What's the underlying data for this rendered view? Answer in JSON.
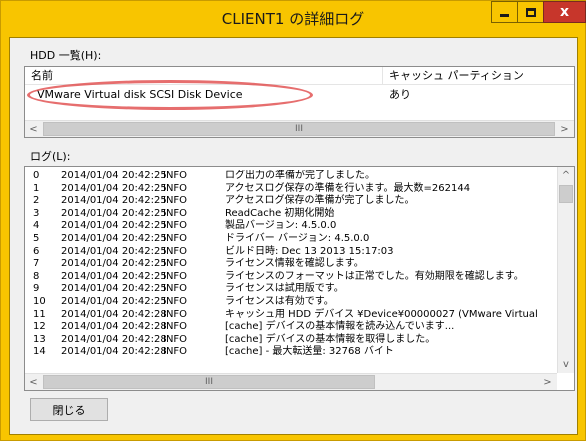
{
  "window": {
    "title": "CLIENT1 の詳細ログ",
    "controls": {
      "minimize": "–",
      "maximize": "□",
      "close": "x"
    }
  },
  "hdd": {
    "label": "HDD 一覧(H):",
    "columns": [
      "名前",
      "キャッシュ パーティション"
    ],
    "rows": [
      {
        "name": "VMware Virtual disk SCSI Disk Device",
        "cache_partition": "あり"
      }
    ],
    "scroll": {
      "left": "<",
      "thumb": "III",
      "right": ">"
    }
  },
  "log": {
    "label": "ログ(L):",
    "lines": [
      {
        "n": "0",
        "ts": "2014/01/04 20:42:25",
        "lv": "INFO",
        "msg": "ログ出力の準備が完了しました。"
      },
      {
        "n": "1",
        "ts": "2014/01/04 20:42:25",
        "lv": "INFO",
        "msg": "アクセスログ保存の準備を行います。最大数=262144"
      },
      {
        "n": "2",
        "ts": "2014/01/04 20:42:25",
        "lv": "INFO",
        "msg": "アクセスログ保存の準備が完了しました。"
      },
      {
        "n": "3",
        "ts": "2014/01/04 20:42:25",
        "lv": "INFO",
        "msg": "ReadCache 初期化開始"
      },
      {
        "n": "4",
        "ts": "2014/01/04 20:42:25",
        "lv": "INFO",
        "msg": "製品バージョン:       4.5.0.0"
      },
      {
        "n": "5",
        "ts": "2014/01/04 20:42:25",
        "lv": "INFO",
        "msg": "ドライバー バージョン: 4.5.0.0"
      },
      {
        "n": "6",
        "ts": "2014/01/04 20:42:25",
        "lv": "INFO",
        "msg": "ビルド日時:           Dec 13 2013 15:17:03"
      },
      {
        "n": "7",
        "ts": "2014/01/04 20:42:25",
        "lv": "INFO",
        "msg": "ライセンス情報を確認します。"
      },
      {
        "n": "8",
        "ts": "2014/01/04 20:42:25",
        "lv": "INFO",
        "msg": "ライセンスのフォーマットは正常でした。有効期限を確認します。"
      },
      {
        "n": "9",
        "ts": "2014/01/04 20:42:25",
        "lv": "INFO",
        "msg": "ライセンスは試用版です。"
      },
      {
        "n": "10",
        "ts": "2014/01/04 20:42:25",
        "lv": "INFO",
        "msg": "ライセンスは有効です。"
      },
      {
        "n": "11",
        "ts": "2014/01/04 20:42:28",
        "lv": "INFO",
        "msg": "キャッシュ用 HDD デバイス ¥Device¥00000027 (VMware Virtual"
      },
      {
        "n": "12",
        "ts": "2014/01/04 20:42:28",
        "lv": "INFO",
        "msg": "[cache] デバイスの基本情報を読み込んでいます..."
      },
      {
        "n": "13",
        "ts": "2014/01/04 20:42:28",
        "lv": "INFO",
        "msg": "[cache] デバイスの基本情報を取得しました。"
      },
      {
        "n": "14",
        "ts": "2014/01/04 20:42:28",
        "lv": "INFO",
        "msg": "[cache]  - 最大転送量:     32768 バイト"
      }
    ],
    "scroll": {
      "left": "<",
      "thumb": "III",
      "right": ">",
      "up": "^",
      "down": "v"
    }
  },
  "buttons": {
    "close": "閉じる"
  },
  "colors": {
    "frame": "#f8c500",
    "close_button": "#c7362b",
    "highlight_ellipse": "#e04a4a"
  }
}
